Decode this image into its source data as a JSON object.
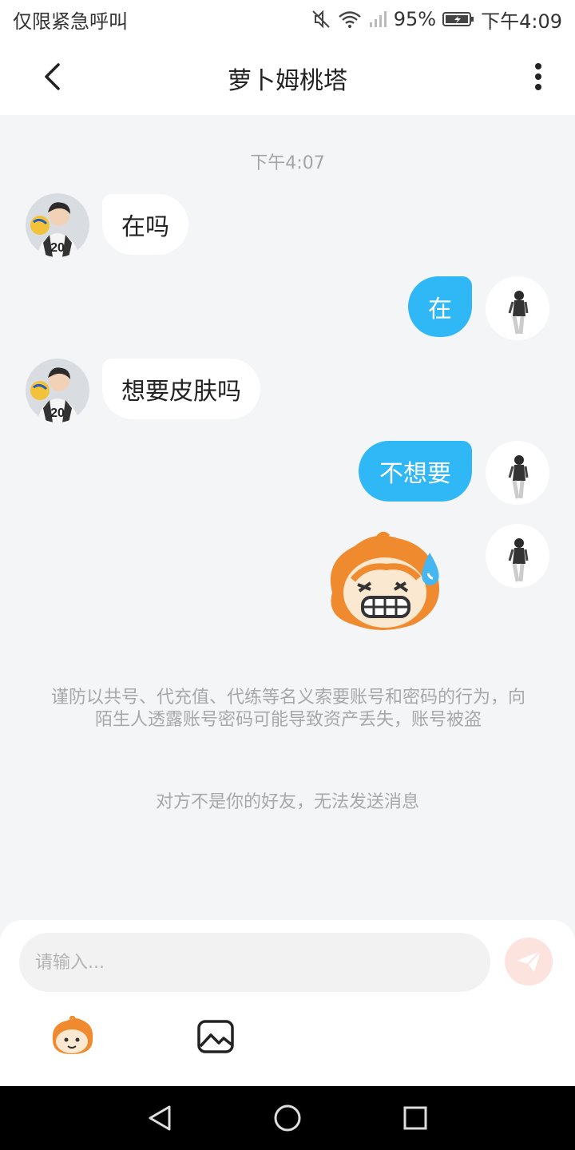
{
  "status_bar": {
    "left_text": "仅限紧急呼叫",
    "battery": "95%",
    "time": "下午4:09"
  },
  "nav": {
    "title": "萝卜姆桃塔"
  },
  "chat": {
    "timestamp": "下午4:07",
    "messages": [
      {
        "side": "incoming",
        "text": "在吗"
      },
      {
        "side": "outgoing",
        "text": "在"
      },
      {
        "side": "incoming",
        "text": "想要皮肤吗"
      },
      {
        "side": "outgoing",
        "text": "不想要"
      },
      {
        "side": "outgoing",
        "type": "sticker",
        "icon": "sweating-face-sticker"
      }
    ],
    "notice": "谨防以共号、代充值、代练等名义索要账号和密码的行为，向陌生人透露账号密码可能导致资产丢失，账号被盗",
    "not_friend": "对方不是你的好友，无法发送消息",
    "avatar_number": "20"
  },
  "input": {
    "placeholder": "请输入..."
  },
  "colors": {
    "accent": "#2fb8f5",
    "background": "#f4f5f7",
    "send_disabled": "#fce3de"
  }
}
